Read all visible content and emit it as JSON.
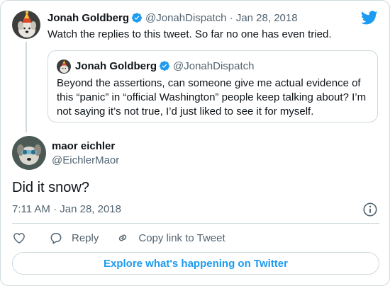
{
  "colors": {
    "accent": "#1d9bf0",
    "text": "#0f1419",
    "secondary": "#536471",
    "border": "#cfd9de"
  },
  "parent_tweet": {
    "avatar_icon": "dog-party-hat-avatar",
    "name": "Jonah Goldberg",
    "handle": "@JonahDispatch",
    "separator": "·",
    "date": "Jan 28, 2018",
    "text": "Watch the replies to this tweet. So far no one has even tried.",
    "quoted": {
      "name": "Jonah Goldberg",
      "handle": "@JonahDispatch",
      "text": "Beyond the assertions, can someone give me actual evidence of this “panic” in “official Washington” people keep talking about? I’m not saying it’s not true, I’d just liked to see it for myself."
    }
  },
  "main_tweet": {
    "avatar_icon": "dog-avatar",
    "name": "maor eichler",
    "handle": "@EichlerMaor",
    "text": "Did it snow?",
    "timestamp": "7:11 AM · Jan 28, 2018"
  },
  "actions": {
    "reply_label": "Reply",
    "copy_link_label": "Copy link to Tweet"
  },
  "explore_label": "Explore what's happening on Twitter"
}
